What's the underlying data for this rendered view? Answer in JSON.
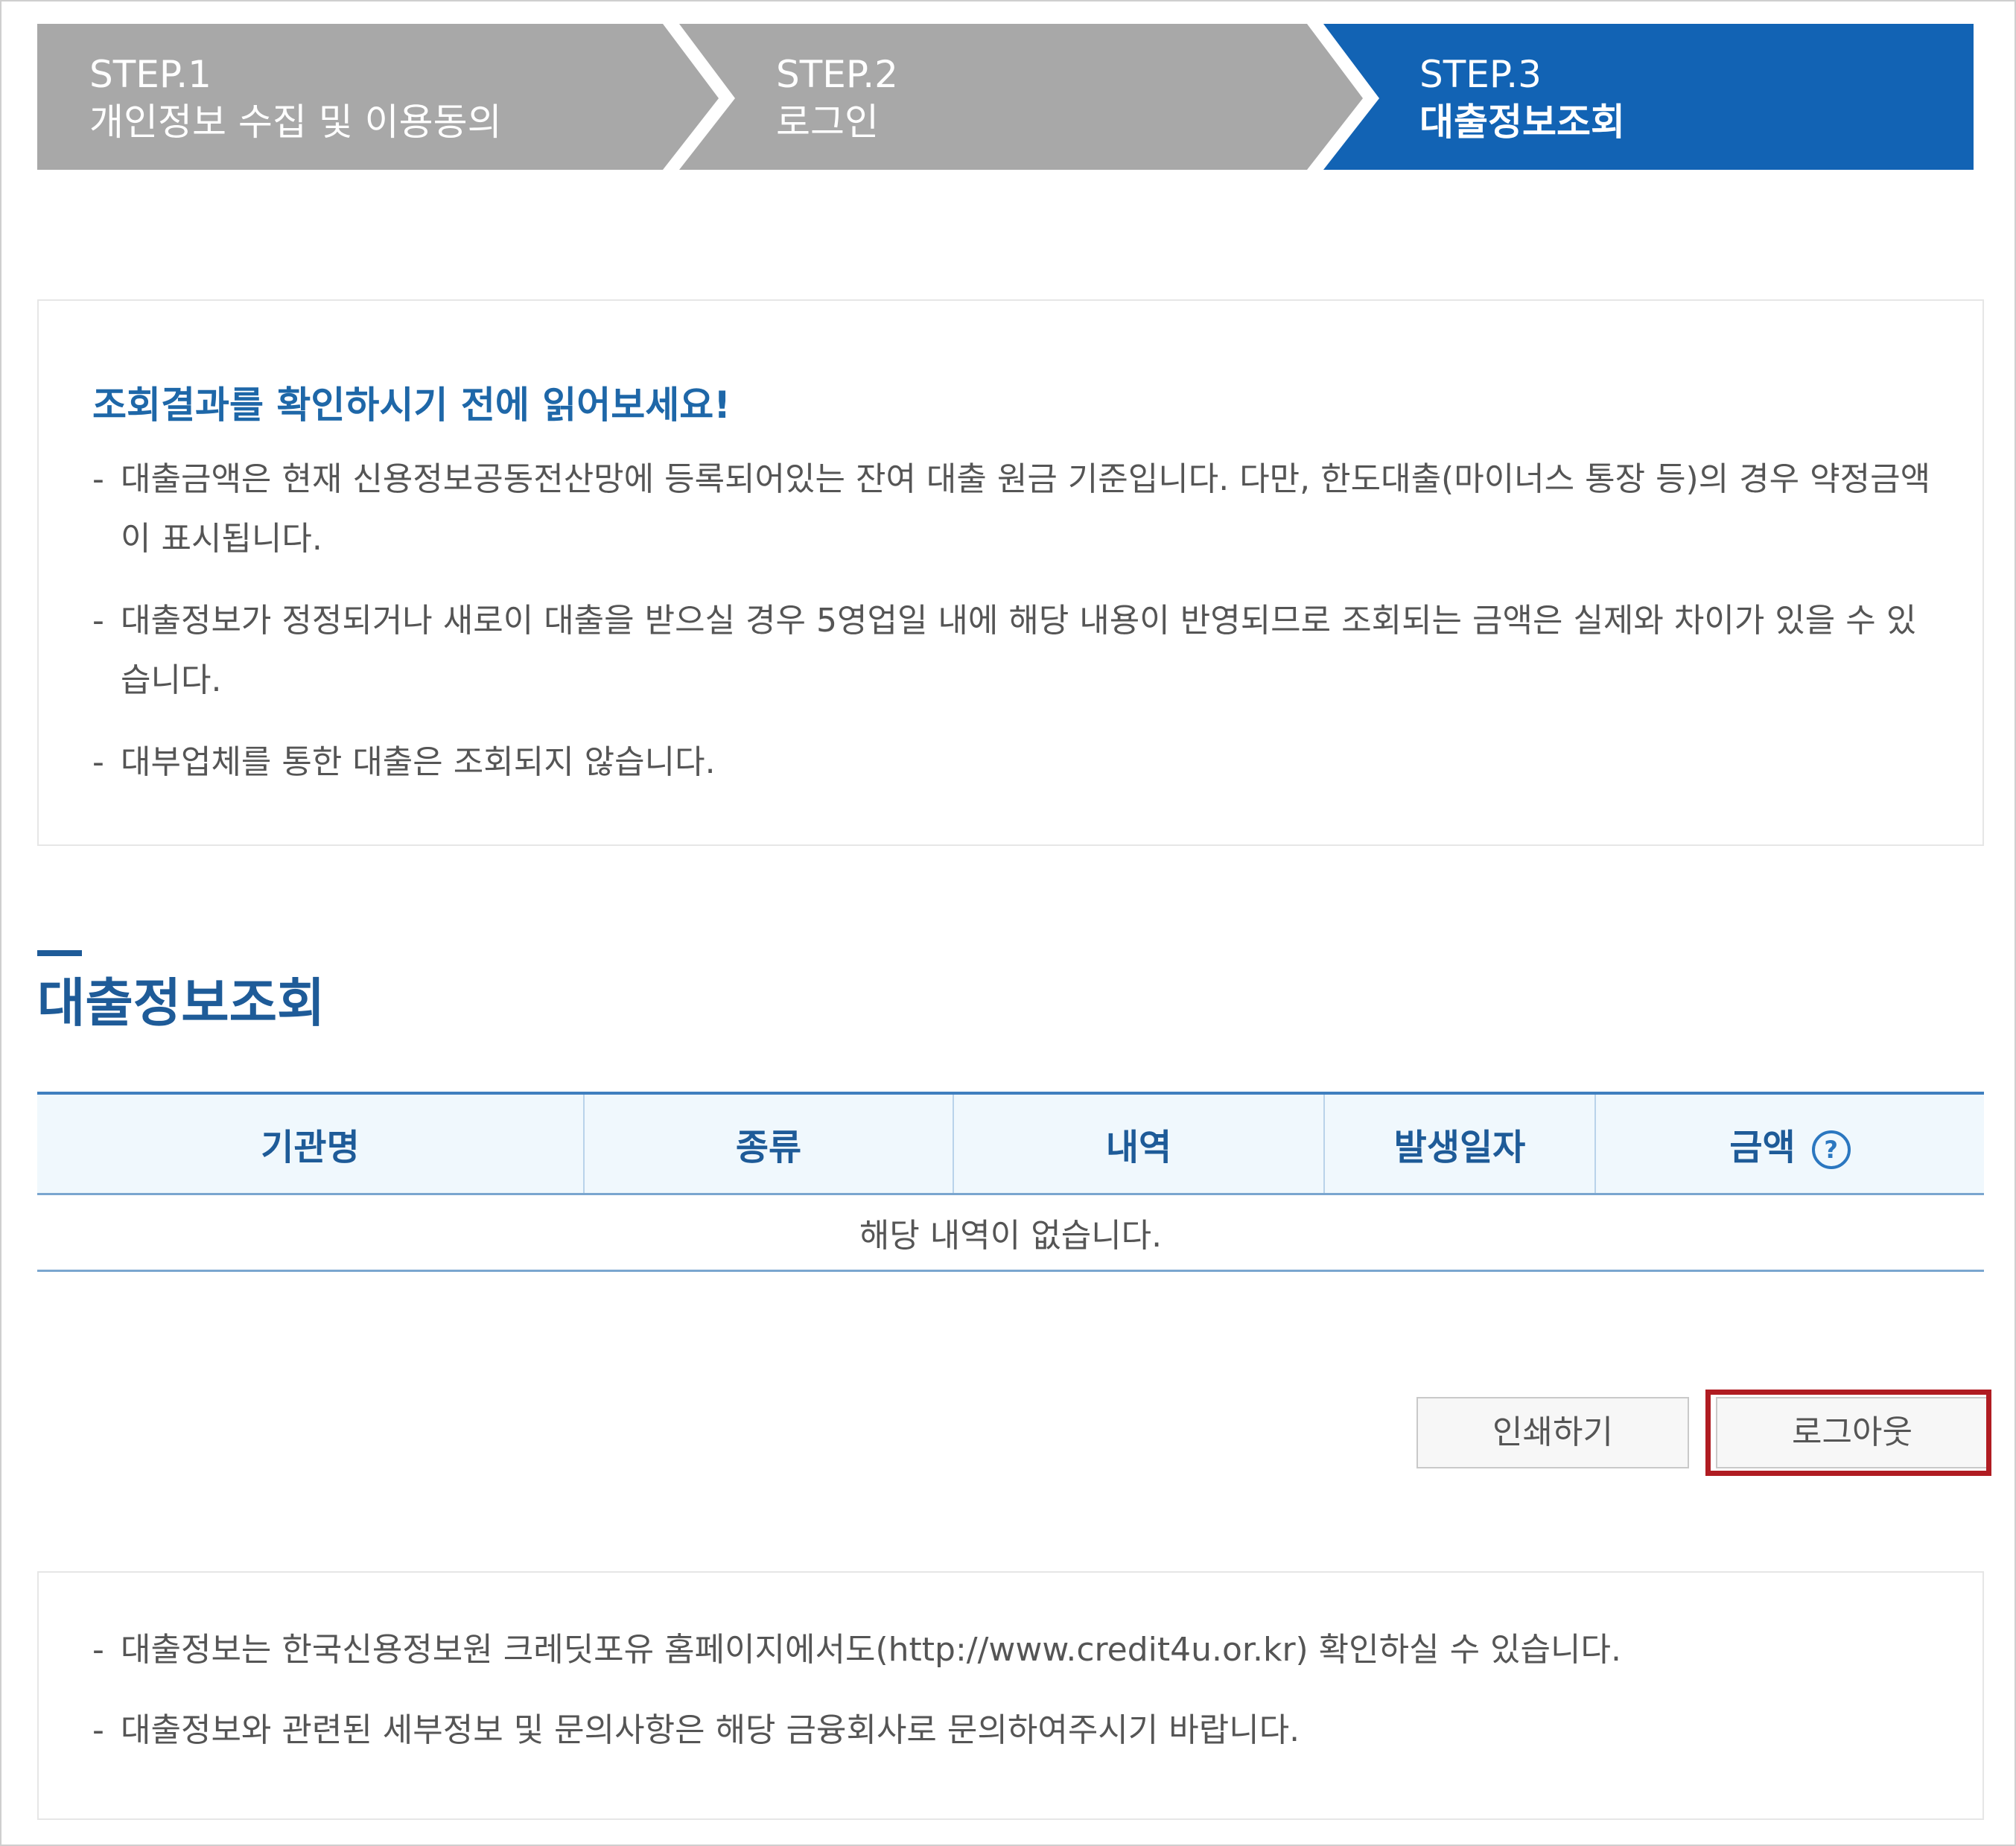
{
  "colors": {
    "step_inactive": "#a8a8a8",
    "step_active": "#1263b4",
    "accent_blue": "#1e5b98",
    "highlight_red": "#b01c22"
  },
  "steps": [
    {
      "num": "STEP.1",
      "title": "개인정보 수집 및 이용동의",
      "active": false
    },
    {
      "num": "STEP.2",
      "title": "로그인",
      "active": false
    },
    {
      "num": "STEP.3",
      "title": "대출정보조회",
      "active": true
    }
  ],
  "notice": {
    "title": "조회결과를 확인하시기 전에 읽어보세요!",
    "dash": "-",
    "items": [
      "대출금액은 현재 신용정보공동전산망에 등록되어있는 잔여 대출 원금 기준입니다. 다만, 한도대출(마이너스 통장 등)의 경우 약정금액이 표시됩니다.",
      "대출정보가 정정되거나 새로이 대출을 받으실 경우 5영업일 내에 해당 내용이 반영되므로 조회되는 금액은 실제와 차이가 있을 수 있습니다.",
      "대부업체를 통한 대출은 조회되지 않습니다."
    ]
  },
  "section": {
    "title": "대출정보조회"
  },
  "table": {
    "headers": [
      "기관명",
      "종류",
      "내역",
      "발생일자",
      "금액"
    ],
    "help_icon": "?",
    "empty_message": "해당 내역이 없습니다."
  },
  "buttons": {
    "print": "인쇄하기",
    "logout": "로그아웃"
  },
  "info": {
    "items": [
      "대출정보는 한국신용정보원 크레딧포유 홈페이지에서도(http://www.credit4u.or.kr) 확인하실 수 있습니다.",
      "대출정보와 관련된 세부정보 및 문의사항은 해당 금융회사로 문의하여주시기 바랍니다."
    ]
  }
}
